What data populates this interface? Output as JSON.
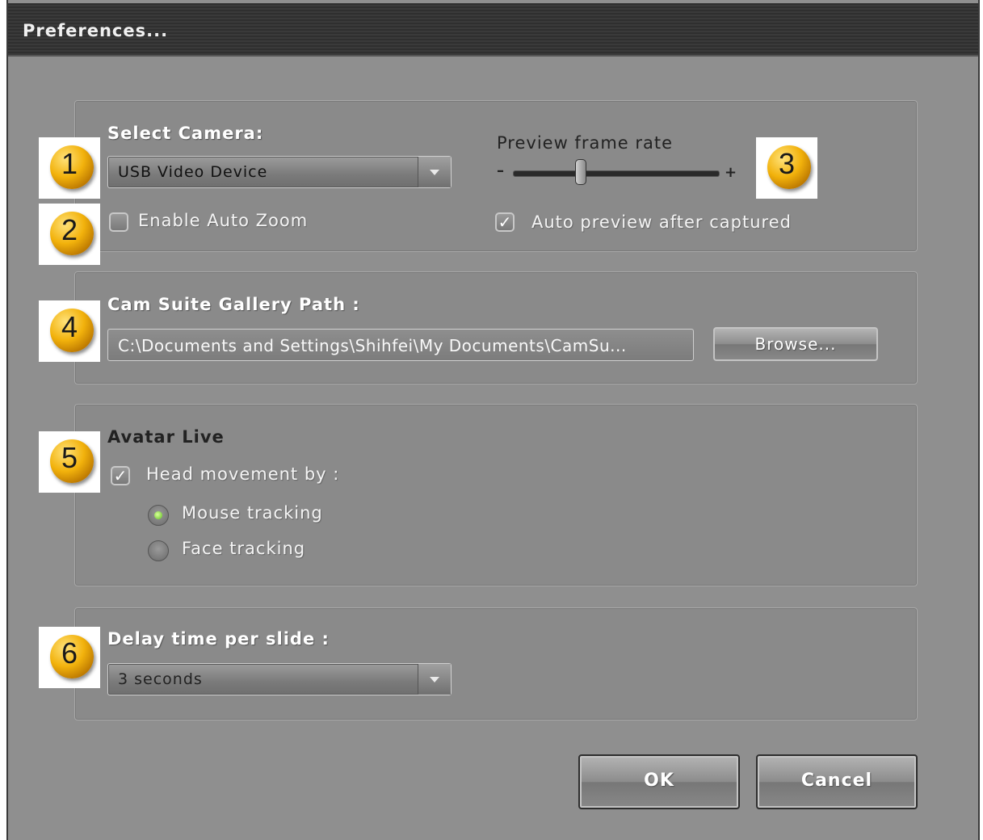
{
  "window": {
    "title": "Preferences..."
  },
  "camera": {
    "label": "Select Camera:",
    "selected": "USB Video Device",
    "auto_zoom_label": "Enable Auto Zoom",
    "auto_zoom_checked": false
  },
  "preview": {
    "label": "Preview frame rate",
    "minus": "–",
    "plus": "+",
    "frame_rate_fraction": 0.33,
    "auto_preview_label": "Auto preview after captured",
    "auto_preview_checked": true
  },
  "gallery": {
    "label": "Cam Suite Gallery Path :",
    "path": "C:\\Documents and Settings\\Shihfei\\My Documents\\CamSu...",
    "browse_label": "Browse..."
  },
  "avatar": {
    "label": "Avatar Live",
    "head_movement_label": "Head movement by :",
    "head_movement_checked": true,
    "options": [
      {
        "label": "Mouse tracking",
        "selected": true
      },
      {
        "label": "Face tracking",
        "selected": false
      }
    ]
  },
  "delay": {
    "label": "Delay time per slide :",
    "selected": "3 seconds"
  },
  "buttons": {
    "ok": "OK",
    "cancel": "Cancel"
  },
  "badges": [
    "1",
    "2",
    "3",
    "4",
    "5",
    "6"
  ],
  "colors": {
    "badge": "#f2b20c",
    "radio_on": "#5fbf1f"
  }
}
